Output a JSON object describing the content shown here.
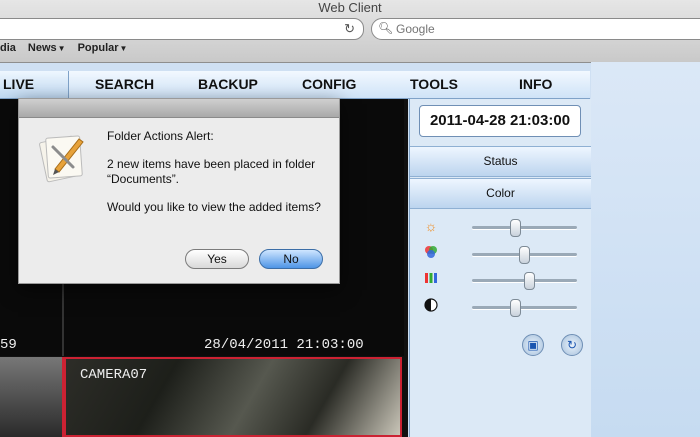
{
  "browser": {
    "window_title": "Web Client",
    "search_placeholder": "Google",
    "bookmarks": [
      {
        "label": "dia"
      },
      {
        "label": "News",
        "menu": true
      },
      {
        "label": "Popular",
        "menu": true
      }
    ]
  },
  "nav": {
    "items": [
      "LIVE",
      "SEARCH",
      "BACKUP",
      "CONFIG",
      "TOOLS",
      "INFO"
    ],
    "active": "LIVE"
  },
  "cameras": {
    "panel1_time_fragment": "59",
    "panel2_timestamp": "28/04/2011  21:03:00",
    "panel4_label": "CAMERA07"
  },
  "right_panel": {
    "datetime": "2011-04-28 21:03:00",
    "status_label": "Status",
    "color_label": "Color",
    "sliders": [
      {
        "icon": "brightness-icon",
        "value_pct": 40
      },
      {
        "icon": "color-circles-icon",
        "value_pct": 50
      },
      {
        "icon": "color-bars-icon",
        "value_pct": 55
      },
      {
        "icon": "contrast-icon",
        "value_pct": 40
      }
    ],
    "buttons": [
      {
        "icon": "save-icon"
      },
      {
        "icon": "refresh-icon"
      }
    ]
  },
  "dialog": {
    "title": "Folder Actions Alert:",
    "message": "2 new items have been placed in folder “Documents”.",
    "question": "Would you like to view the added items?",
    "yes_label": "Yes",
    "no_label": "No"
  }
}
